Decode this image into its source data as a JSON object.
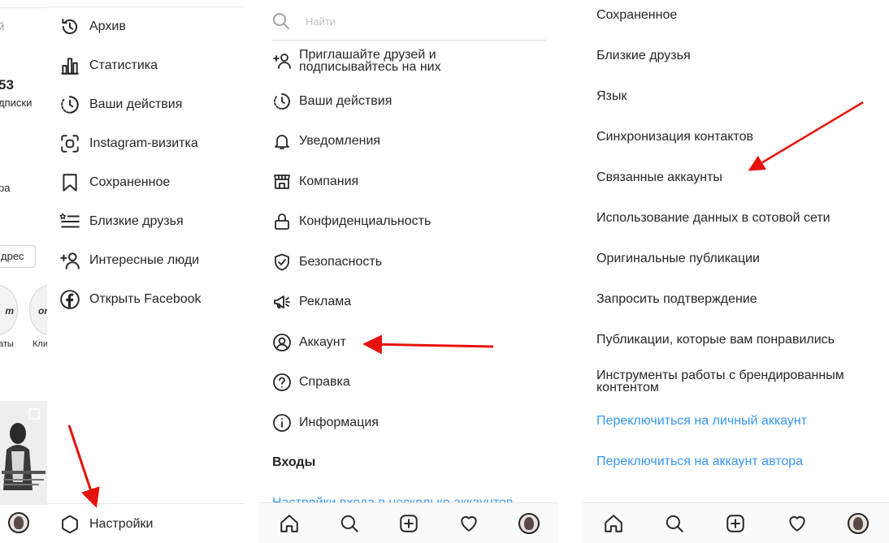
{
  "panel1": {
    "profile_fragments": {
      "search_partial": "й",
      "count": "53",
      "count_label": "дписки",
      "bio_partial": "ра",
      "button_partial": "дрес",
      "highlight1_partial": "аты",
      "highlight2_partial": "Кли"
    },
    "menu": [
      {
        "label": "Архив",
        "icon": "archive-icon"
      },
      {
        "label": "Статистика",
        "icon": "stats-icon"
      },
      {
        "label": "Ваши действия",
        "icon": "activity-icon"
      },
      {
        "label": "Instagram-визитка",
        "icon": "nametag-icon"
      },
      {
        "label": "Сохраненное",
        "icon": "bookmark-icon"
      },
      {
        "label": "Близкие друзья",
        "icon": "close-friends-icon"
      },
      {
        "label": "Интересные люди",
        "icon": "discover-people-icon"
      },
      {
        "label": "Открыть Facebook",
        "icon": "facebook-icon"
      }
    ],
    "settings_label": "Настройки"
  },
  "panel2": {
    "search_placeholder": "Найти",
    "menu": [
      {
        "label": "Приглашайте друзей и подписывайтесь на них",
        "icon": "follow-invite-icon"
      },
      {
        "label": "Ваши действия",
        "icon": "activity-icon"
      },
      {
        "label": "Уведомления",
        "icon": "bell-icon"
      },
      {
        "label": "Компания",
        "icon": "shop-icon"
      },
      {
        "label": "Конфиденциальность",
        "icon": "lock-icon"
      },
      {
        "label": "Безопасность",
        "icon": "shield-icon"
      },
      {
        "label": "Реклама",
        "icon": "megaphone-icon"
      },
      {
        "label": "Аккаунт",
        "icon": "account-icon"
      },
      {
        "label": "Справка",
        "icon": "help-icon"
      },
      {
        "label": "Информация",
        "icon": "info-icon"
      }
    ],
    "logins_header": "Входы",
    "multi_login_link": "Настройки входа в несколько аккаунтов"
  },
  "panel3": {
    "menu": [
      "Сохраненное",
      "Близкие друзья",
      "Язык",
      "Синхронизация контактов",
      "Связанные аккаунты",
      "Использование данных в сотовой сети",
      "Оригинальные публикации",
      "Запросить подтверждение",
      "Публикации, которые вам понравились",
      "Инструменты работы с брендированным контентом"
    ],
    "switch_personal": "Переключиться на личный аккаунт",
    "switch_creator": "Переключиться на аккаунт автора"
  },
  "bottom_nav": [
    "home-icon",
    "search-icon",
    "new-post-icon",
    "heart-icon",
    "profile-avatar"
  ],
  "colors": {
    "link": "#3897f0",
    "arrow": "#e8120c",
    "text": "#262626",
    "divider": "#e6e6e6"
  }
}
